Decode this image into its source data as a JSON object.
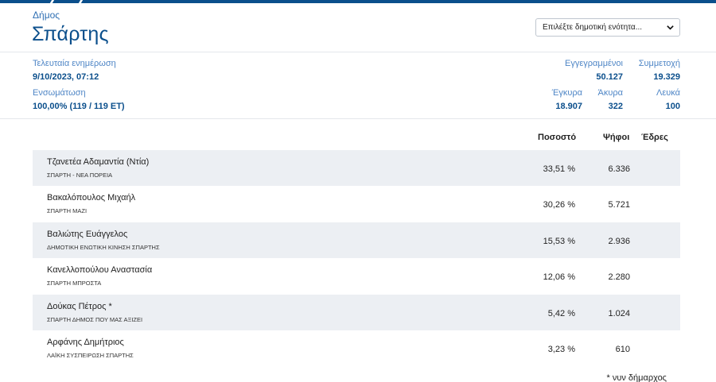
{
  "header": {
    "kicker": "Δήμος",
    "title": "Σπάρτης",
    "unit_select_placeholder": "Επιλέξτε δημοτική ενότητα..."
  },
  "meta": {
    "last_update_label": "Τελευταία ενημέρωση",
    "last_update_value": "9/10/2023, 07:12",
    "integration_label": "Ενσωμάτωση",
    "integration_value": "100,00% (119 / 119 ΕΤ)",
    "registered_label": "Εγγεγραμμένοι",
    "registered_value": "50.127",
    "turnout_label": "Συμμετοχή",
    "turnout_value": "19.329",
    "valid_label": "Έγκυρα",
    "valid_value": "18.907",
    "invalid_label": "Άκυρα",
    "invalid_value": "322",
    "blank_label": "Λευκά",
    "blank_value": "100"
  },
  "results": {
    "columns": {
      "percent": "Ποσοστό",
      "votes": "Ψήφοι",
      "seats": "Έδρες"
    },
    "rows": [
      {
        "name": "Τζανετέα Αδαμαντία (Ντία)",
        "party": "ΣΠΑΡΤΗ - ΝΕΑ ΠΟΡΕΙΑ",
        "percent": "33,51 %",
        "votes": "6.336",
        "seats": ""
      },
      {
        "name": "Βακαλόπουλος Μιχαήλ",
        "party": "ΣΠΑΡΤΗ ΜΑΖΙ",
        "percent": "30,26 %",
        "votes": "5.721",
        "seats": ""
      },
      {
        "name": "Βαλιώτης Ευάγγελος",
        "party": "ΔΗΜΟΤΙΚΗ ΕΝΩΤΙΚΗ ΚΙΝΗΣΗ ΣΠΑΡΤΗΣ",
        "percent": "15,53 %",
        "votes": "2.936",
        "seats": ""
      },
      {
        "name": "Κανελλοπούλου Αναστασία",
        "party": "ΣΠΑΡΤΗ ΜΠΡΟΣΤΑ",
        "percent": "12,06 %",
        "votes": "2.280",
        "seats": ""
      },
      {
        "name": "Δούκας Πέτρος *",
        "party": "ΣΠΑΡΤΗ ΔΗΜΟΣ ΠΟΥ ΜΑΣ ΑΞΙΖΕΙ",
        "percent": "5,42 %",
        "votes": "1.024",
        "seats": ""
      },
      {
        "name": "Αρφάνης Δημήτριος",
        "party": "ΛΑΪΚΗ ΣΥΣΠΕΙΡΩΣΗ ΣΠΑΡΤΗΣ",
        "percent": "3,23 %",
        "votes": "610",
        "seats": ""
      }
    ],
    "footnote": "* νυν δήμαρχος"
  },
  "colors": {
    "brand": "#0b4f8c",
    "label_blue": "#4f86c6",
    "row_shade": "#eceff3"
  }
}
